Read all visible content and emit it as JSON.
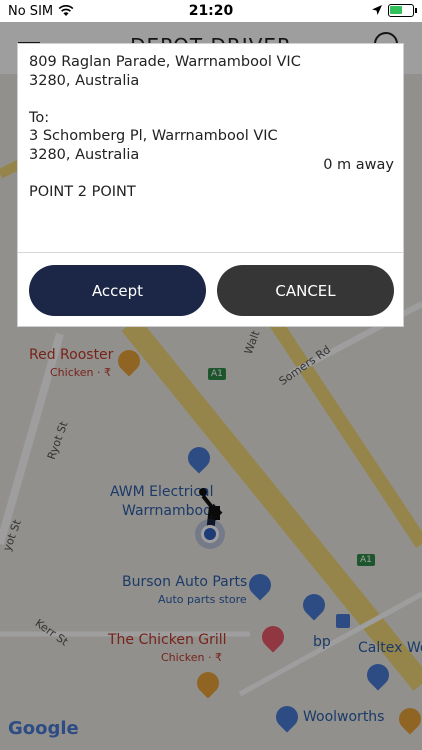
{
  "status_bar": {
    "carrier": "No SIM",
    "time": "21:20"
  },
  "header": {
    "title": "DEPOT DRIVER"
  },
  "map": {
    "pois": {
      "red_rooster": "Red Rooster",
      "red_rooster_sub": "Chicken · ₹",
      "awm_line1": "AWM Electrical",
      "awm_line2": "Warrnambool",
      "burson": "Burson Auto Parts",
      "burson_sub": "Auto parts store",
      "chicken_grill": "The Chicken Grill",
      "chicken_grill_sub": "Chicken · ₹",
      "bp": "bp",
      "caltex": "Caltex Wo",
      "woolworths": "Woolworths"
    },
    "roads": {
      "somers": "Somers Rd",
      "walt": "Walt",
      "ryot": "Ryot St",
      "ryot2": "yot St",
      "kerr": "Kerr St"
    },
    "highway": "A1",
    "attribution": "Google"
  },
  "dialog": {
    "pickup_line1": "809 Raglan Parade, Warrnambool VIC",
    "pickup_line2": "3280, Australia",
    "to_label": "To:",
    "dropoff_line1": "3 Schomberg Pl, Warrnambool VIC",
    "dropoff_line2": "3280, Australia",
    "distance": "0 m away",
    "trip_type": "POINT 2 POINT",
    "accept_label": "Accept",
    "cancel_label": "CANCEL"
  },
  "colors": {
    "accept": "#1c2646",
    "cancel": "#363636",
    "road": "#f2d77a"
  }
}
